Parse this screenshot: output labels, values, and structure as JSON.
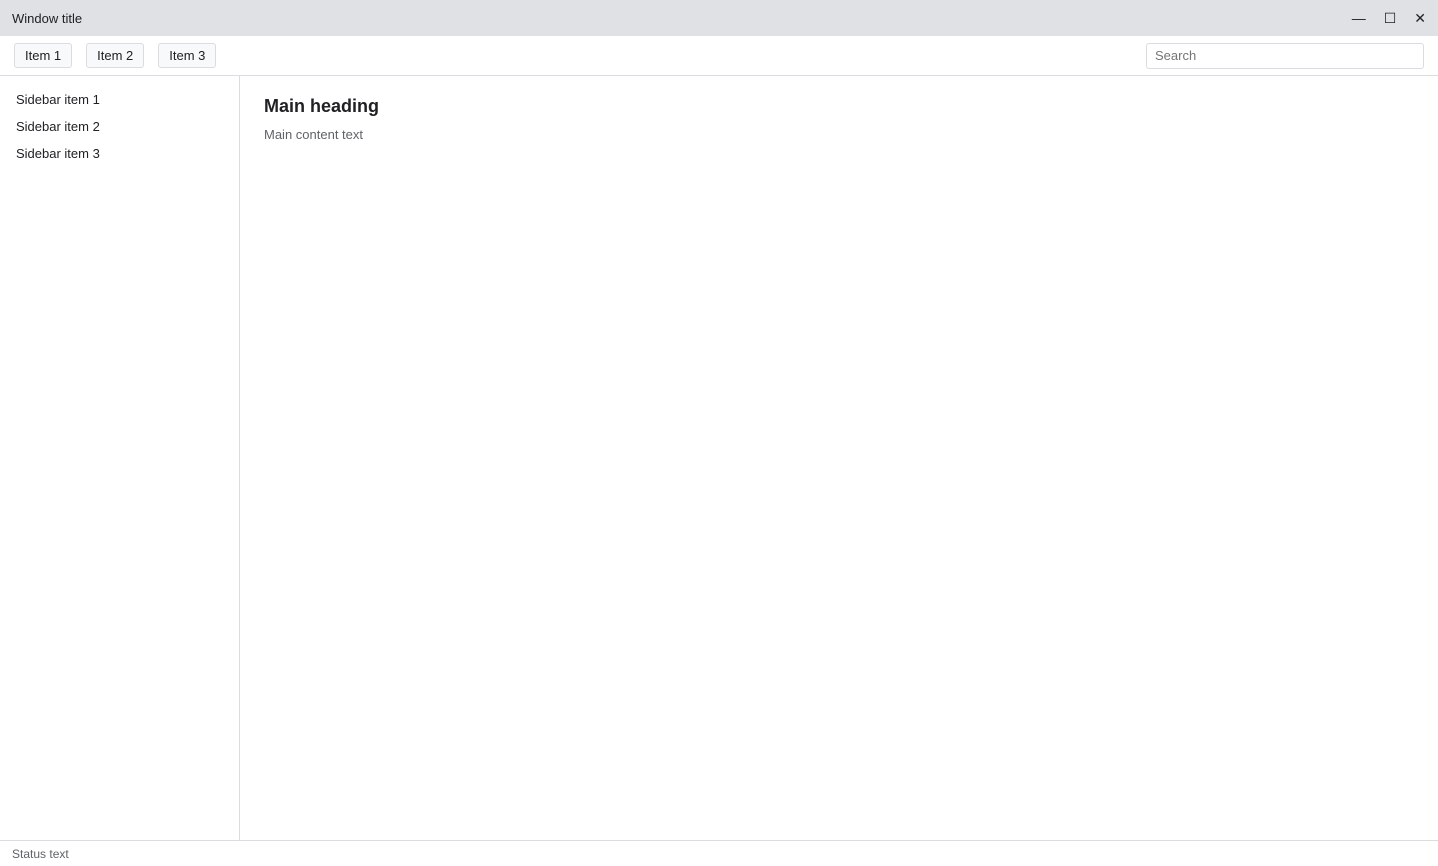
{
  "window": {
    "title": "Window title",
    "minimize": "—",
    "maximize": "☐",
    "close": "✕"
  },
  "toolbar": {
    "items": [
      "Item 1",
      "Item 2",
      "Item 3"
    ],
    "search_placeholder": "Search"
  },
  "sidebar": {
    "items": [
      {
        "label": "Sidebar item 1"
      },
      {
        "label": "Sidebar item 2"
      },
      {
        "label": "Sidebar item 3"
      }
    ]
  },
  "main": {
    "heading": "Main heading",
    "text": "Main content text"
  },
  "status": {
    "text": "Status text"
  }
}
